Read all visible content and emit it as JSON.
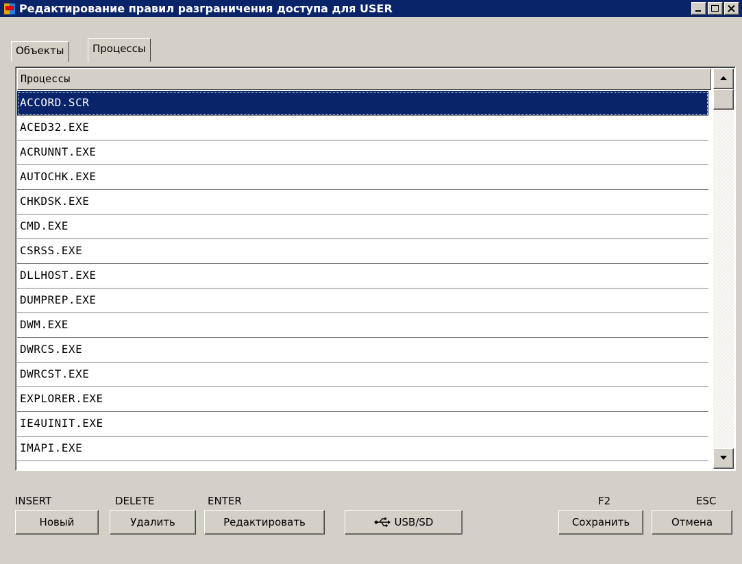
{
  "window": {
    "title": "Редактирование правил разграничения доступа для USER"
  },
  "tabs": [
    {
      "label": "Объекты",
      "active": false
    },
    {
      "label": "Процессы",
      "active": true
    }
  ],
  "list": {
    "header": "Процессы",
    "selected_index": 0,
    "items": [
      "ACCORD.SCR",
      "ACED32.EXE",
      "ACRUNNT.EXE",
      "AUTOCHK.EXE",
      "CHKDSK.EXE",
      "CMD.EXE",
      "CSRSS.EXE",
      "DLLHOST.EXE",
      "DUMPREP.EXE",
      "DWM.EXE",
      "DWRCS.EXE",
      "DWRCST.EXE",
      "EXPLORER.EXE",
      "IE4UINIT.EXE",
      "IMAPI.EXE"
    ]
  },
  "keys": {
    "insert": "INSERT",
    "delete": "DELETE",
    "enter": "ENTER",
    "f2": "F2",
    "esc": "ESC"
  },
  "buttons": {
    "new": "Новый",
    "delete": "Удалить",
    "edit": "Редактировать",
    "usb": "USB/SD",
    "save": "Сохранить",
    "cancel": "Отмена"
  },
  "colors": {
    "titlebar": "#0a246a",
    "selection": "#0a246a",
    "face": "#d4d0c8"
  }
}
